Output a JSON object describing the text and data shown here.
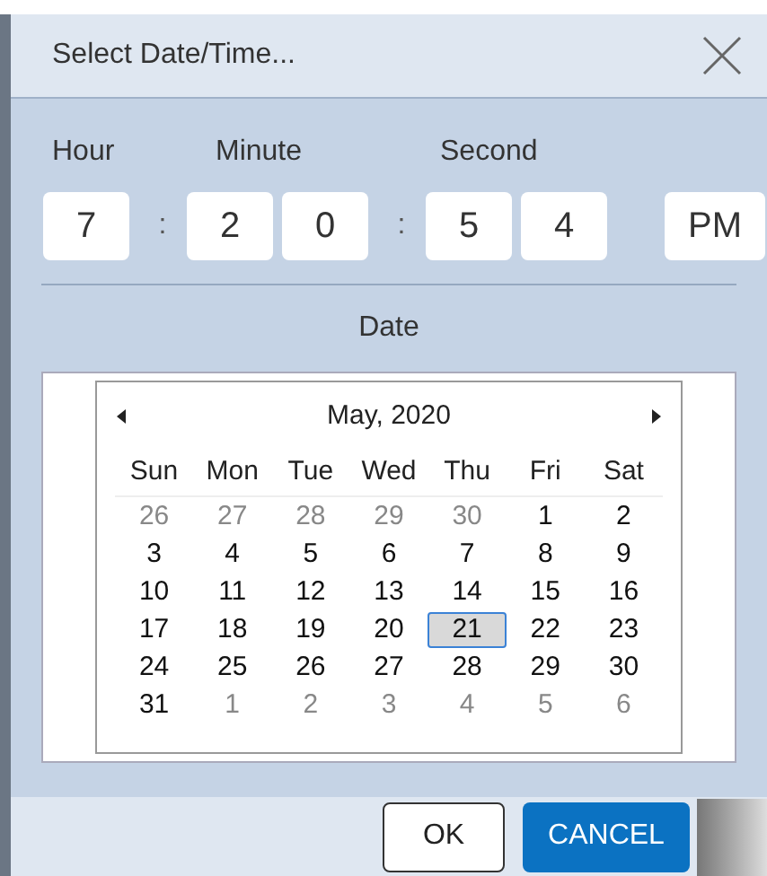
{
  "window": {
    "title": "Select Date/Time..."
  },
  "time": {
    "labels": [
      "Hour",
      "Minute",
      "Second"
    ],
    "fields": [
      {
        "kind": "box",
        "value": "7"
      },
      {
        "kind": "colon",
        "value": ":"
      },
      {
        "kind": "box",
        "value": "2"
      },
      {
        "kind": "box",
        "value": "0"
      },
      {
        "kind": "colon",
        "value": ":"
      },
      {
        "kind": "box",
        "value": "5"
      },
      {
        "kind": "box",
        "value": "4"
      },
      {
        "kind": "ampm",
        "value": "PM"
      }
    ]
  },
  "date_label": "Date",
  "calendar": {
    "month": "May, 2020",
    "weekdays": [
      "Sun",
      "Mon",
      "Tue",
      "Wed",
      "Thu",
      "Fri",
      "Sat"
    ],
    "days": [
      {
        "label": "26",
        "muted": true,
        "selected": false
      },
      {
        "label": "27",
        "muted": true,
        "selected": false
      },
      {
        "label": "28",
        "muted": true,
        "selected": false
      },
      {
        "label": "29",
        "muted": true,
        "selected": false
      },
      {
        "label": "30",
        "muted": true,
        "selected": false
      },
      {
        "label": "1",
        "muted": false,
        "selected": false
      },
      {
        "label": "2",
        "muted": false,
        "selected": false
      },
      {
        "label": "3",
        "muted": false,
        "selected": false
      },
      {
        "label": "4",
        "muted": false,
        "selected": false
      },
      {
        "label": "5",
        "muted": false,
        "selected": false
      },
      {
        "label": "6",
        "muted": false,
        "selected": false
      },
      {
        "label": "7",
        "muted": false,
        "selected": false
      },
      {
        "label": "8",
        "muted": false,
        "selected": false
      },
      {
        "label": "9",
        "muted": false,
        "selected": false
      },
      {
        "label": "10",
        "muted": false,
        "selected": false
      },
      {
        "label": "11",
        "muted": false,
        "selected": false
      },
      {
        "label": "12",
        "muted": false,
        "selected": false
      },
      {
        "label": "13",
        "muted": false,
        "selected": false
      },
      {
        "label": "14",
        "muted": false,
        "selected": false
      },
      {
        "label": "15",
        "muted": false,
        "selected": false
      },
      {
        "label": "16",
        "muted": false,
        "selected": false
      },
      {
        "label": "17",
        "muted": false,
        "selected": false
      },
      {
        "label": "18",
        "muted": false,
        "selected": false
      },
      {
        "label": "19",
        "muted": false,
        "selected": false
      },
      {
        "label": "20",
        "muted": false,
        "selected": false
      },
      {
        "label": "21",
        "muted": false,
        "selected": true
      },
      {
        "label": "22",
        "muted": false,
        "selected": false
      },
      {
        "label": "23",
        "muted": false,
        "selected": false
      },
      {
        "label": "24",
        "muted": false,
        "selected": false
      },
      {
        "label": "25",
        "muted": false,
        "selected": false
      },
      {
        "label": "26",
        "muted": false,
        "selected": false
      },
      {
        "label": "27",
        "muted": false,
        "selected": false
      },
      {
        "label": "28",
        "muted": false,
        "selected": false
      },
      {
        "label": "29",
        "muted": false,
        "selected": false
      },
      {
        "label": "30",
        "muted": false,
        "selected": false
      },
      {
        "label": "31",
        "muted": false,
        "selected": false
      },
      {
        "label": "1",
        "muted": true,
        "selected": false
      },
      {
        "label": "2",
        "muted": true,
        "selected": false
      },
      {
        "label": "3",
        "muted": true,
        "selected": false
      },
      {
        "label": "4",
        "muted": true,
        "selected": false
      },
      {
        "label": "5",
        "muted": true,
        "selected": false
      },
      {
        "label": "6",
        "muted": true,
        "selected": false
      }
    ]
  },
  "buttons": [
    {
      "kind": "secondary",
      "label": "OK"
    },
    {
      "kind": "primary",
      "label": "CANCEL"
    }
  ]
}
